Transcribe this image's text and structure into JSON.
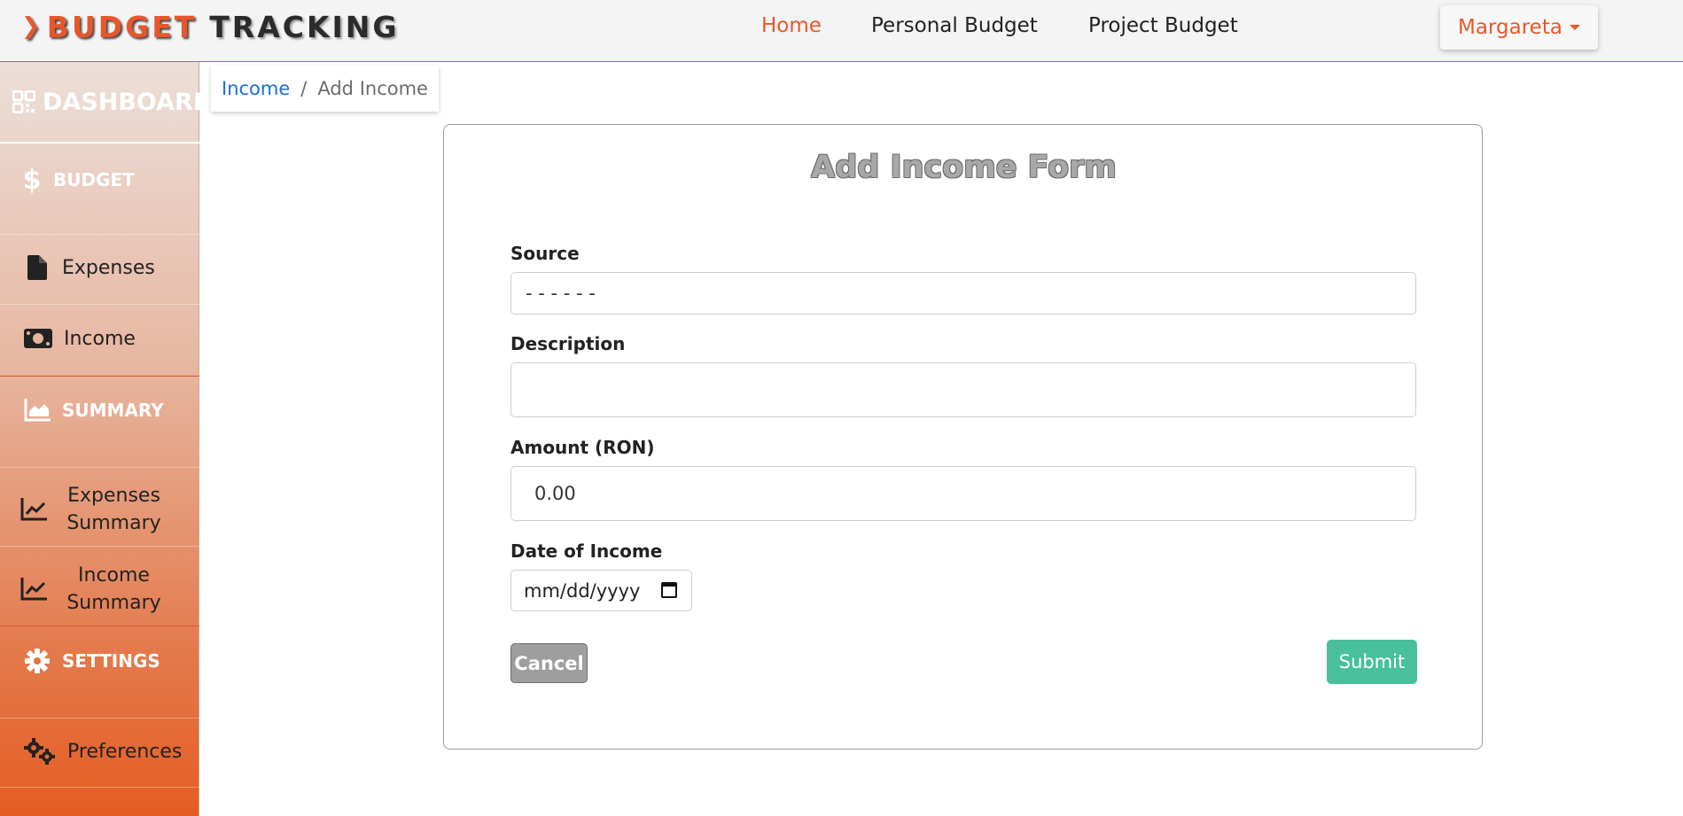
{
  "brand": {
    "prefix": "BUDGET",
    "suffix": "TRACKING"
  },
  "nav": {
    "home": "Home",
    "personal_budget": "Personal Budget",
    "project_budget": "Project Budget",
    "user": "Margareta"
  },
  "sidebar": {
    "dashboard": "DASHBOARD",
    "budget": "BUDGET",
    "expenses": "Expenses",
    "income": "Income",
    "summary": "SUMMARY",
    "expenses_summary": [
      "Expenses",
      "Summary"
    ],
    "income_summary": [
      "Income",
      "Summary"
    ],
    "settings": "SETTINGS",
    "preferences": "Preferences"
  },
  "breadcrumb": {
    "parent": "Income",
    "separator": "/",
    "current": "Add Income"
  },
  "form": {
    "title": "Add Income Form",
    "source_label": "Source",
    "source_value": "- - - - - -",
    "description_label": "Description",
    "description_value": "",
    "amount_label": "Amount (RON)",
    "amount_value": "0.00",
    "date_label": "Date of Income",
    "date_placeholder": "mm/dd/yyyy",
    "cancel": "Cancel",
    "submit": "Submit"
  },
  "colors": {
    "accent": "#e8572a",
    "submit": "#48c09b",
    "link": "#1a6fd6"
  }
}
